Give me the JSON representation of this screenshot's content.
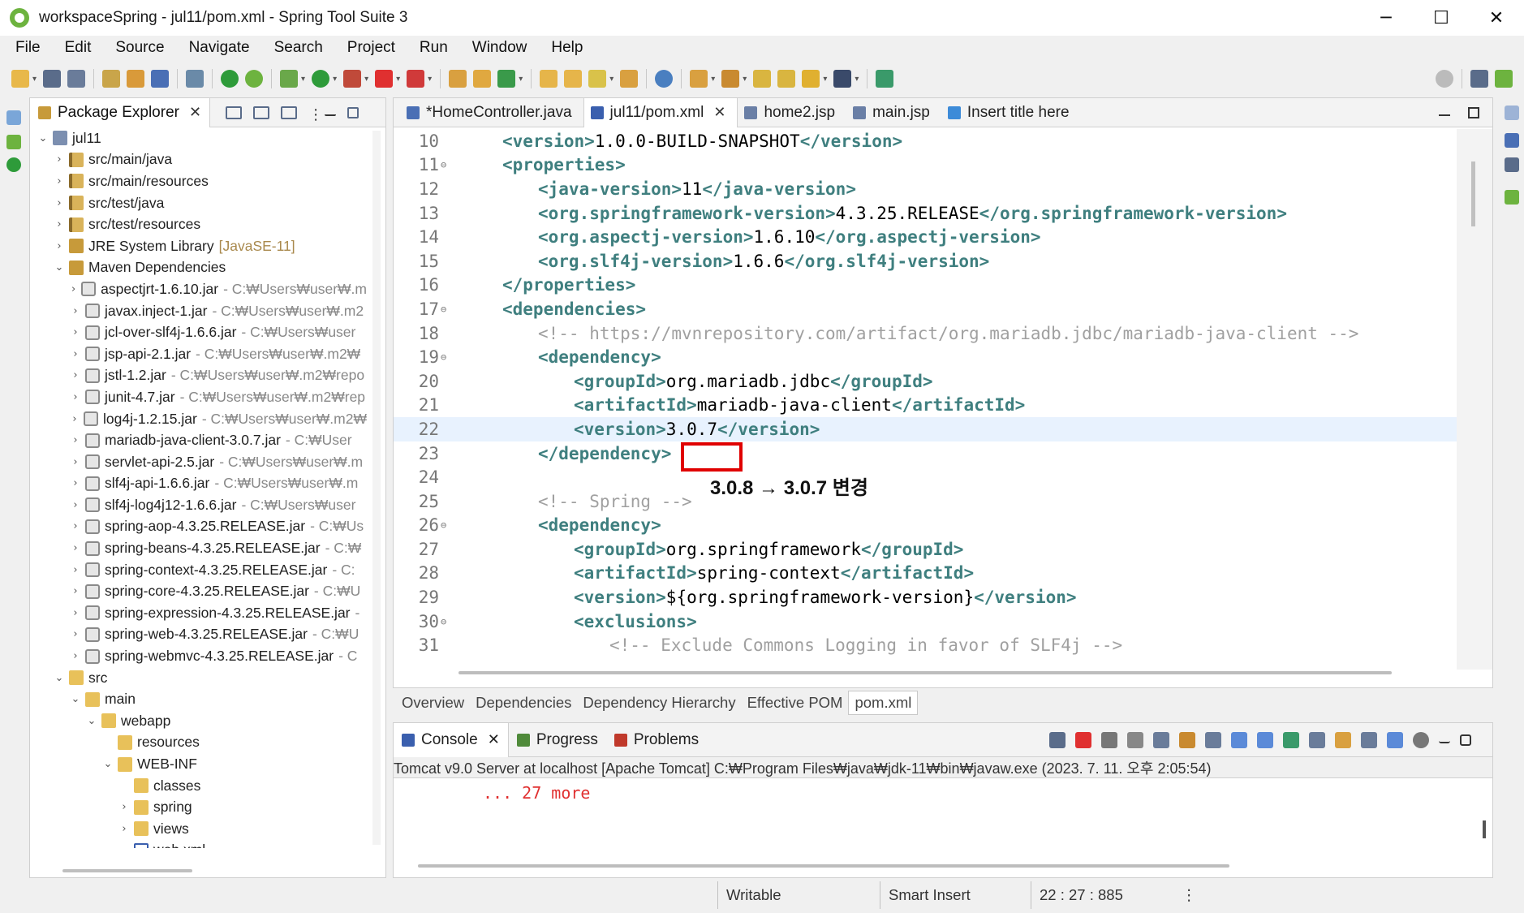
{
  "window": {
    "title": "workspaceSpring - jul11/pom.xml - Spring Tool Suite 3",
    "minimize": "─",
    "maximize": "☐",
    "close": "✕"
  },
  "menu": [
    "File",
    "Edit",
    "Source",
    "Navigate",
    "Search",
    "Project",
    "Run",
    "Window",
    "Help"
  ],
  "package_explorer": {
    "tab_label": "Package Explorer",
    "close": "✕",
    "tree": [
      {
        "depth": 0,
        "arrow": "⌄",
        "icon": "project-icon",
        "label": "jul11",
        "dec": ""
      },
      {
        "depth": 1,
        "arrow": "›",
        "icon": "source-folder-icon",
        "label": "src/main/java",
        "dec": ""
      },
      {
        "depth": 1,
        "arrow": "›",
        "icon": "source-folder-icon",
        "label": "src/main/resources",
        "dec": ""
      },
      {
        "depth": 1,
        "arrow": "›",
        "icon": "source-folder-icon",
        "label": "src/test/java",
        "dec": ""
      },
      {
        "depth": 1,
        "arrow": "›",
        "icon": "source-folder-icon",
        "label": "src/test/resources",
        "dec": ""
      },
      {
        "depth": 1,
        "arrow": "›",
        "icon": "library-icon",
        "label": "JRE System Library",
        "jre": "[JavaSE-11]"
      },
      {
        "depth": 1,
        "arrow": "⌄",
        "icon": "library-icon",
        "label": "Maven Dependencies",
        "dec": ""
      },
      {
        "depth": 2,
        "arrow": "›",
        "icon": "jar-icon",
        "label": "aspectjrt-1.6.10.jar",
        "dec": "- C:₩Users₩user₩.m"
      },
      {
        "depth": 2,
        "arrow": "›",
        "icon": "jar-icon",
        "label": "javax.inject-1.jar",
        "dec": "- C:₩Users₩user₩.m2"
      },
      {
        "depth": 2,
        "arrow": "›",
        "icon": "jar-icon",
        "label": "jcl-over-slf4j-1.6.6.jar",
        "dec": "- C:₩Users₩user"
      },
      {
        "depth": 2,
        "arrow": "›",
        "icon": "jar-icon",
        "label": "jsp-api-2.1.jar",
        "dec": "- C:₩Users₩user₩.m2₩"
      },
      {
        "depth": 2,
        "arrow": "›",
        "icon": "jar-icon",
        "label": "jstl-1.2.jar",
        "dec": "- C:₩Users₩user₩.m2₩repo"
      },
      {
        "depth": 2,
        "arrow": "›",
        "icon": "jar-icon",
        "label": "junit-4.7.jar",
        "dec": "- C:₩Users₩user₩.m2₩rep"
      },
      {
        "depth": 2,
        "arrow": "›",
        "icon": "jar-icon",
        "label": "log4j-1.2.15.jar",
        "dec": "- C:₩Users₩user₩.m2₩"
      },
      {
        "depth": 2,
        "arrow": "›",
        "icon": "jar-icon",
        "label": "mariadb-java-client-3.0.7.jar",
        "dec": "- C:₩User"
      },
      {
        "depth": 2,
        "arrow": "›",
        "icon": "jar-icon",
        "label": "servlet-api-2.5.jar",
        "dec": "- C:₩Users₩user₩.m"
      },
      {
        "depth": 2,
        "arrow": "›",
        "icon": "jar-icon",
        "label": "slf4j-api-1.6.6.jar",
        "dec": "- C:₩Users₩user₩.m"
      },
      {
        "depth": 2,
        "arrow": "›",
        "icon": "jar-icon",
        "label": "slf4j-log4j12-1.6.6.jar",
        "dec": "- C:₩Users₩user"
      },
      {
        "depth": 2,
        "arrow": "›",
        "icon": "jar-icon",
        "label": "spring-aop-4.3.25.RELEASE.jar",
        "dec": "- C:₩Us"
      },
      {
        "depth": 2,
        "arrow": "›",
        "icon": "jar-icon",
        "label": "spring-beans-4.3.25.RELEASE.jar",
        "dec": "- C:₩"
      },
      {
        "depth": 2,
        "arrow": "›",
        "icon": "jar-icon",
        "label": "spring-context-4.3.25.RELEASE.jar",
        "dec": "- C:"
      },
      {
        "depth": 2,
        "arrow": "›",
        "icon": "jar-icon",
        "label": "spring-core-4.3.25.RELEASE.jar",
        "dec": "- C:₩U"
      },
      {
        "depth": 2,
        "arrow": "›",
        "icon": "jar-icon",
        "label": "spring-expression-4.3.25.RELEASE.jar",
        "dec": "-"
      },
      {
        "depth": 2,
        "arrow": "›",
        "icon": "jar-icon",
        "label": "spring-web-4.3.25.RELEASE.jar",
        "dec": "- C:₩U"
      },
      {
        "depth": 2,
        "arrow": "›",
        "icon": "jar-icon",
        "label": "spring-webmvc-4.3.25.RELEASE.jar",
        "dec": "- C"
      },
      {
        "depth": 1,
        "arrow": "⌄",
        "icon": "folder-icon",
        "label": "src",
        "dec": ""
      },
      {
        "depth": 2,
        "arrow": "⌄",
        "icon": "folder-icon",
        "label": "main",
        "dec": ""
      },
      {
        "depth": 3,
        "arrow": "⌄",
        "icon": "folder-icon",
        "label": "webapp",
        "dec": ""
      },
      {
        "depth": 4,
        "arrow": "",
        "icon": "folder-icon",
        "label": "resources",
        "dec": ""
      },
      {
        "depth": 4,
        "arrow": "⌄",
        "icon": "folder-icon",
        "label": "WEB-INF",
        "dec": ""
      },
      {
        "depth": 5,
        "arrow": "",
        "icon": "folder-icon",
        "label": "classes",
        "dec": ""
      },
      {
        "depth": 5,
        "arrow": "›",
        "icon": "folder-icon",
        "label": "spring",
        "dec": ""
      },
      {
        "depth": 5,
        "arrow": "›",
        "icon": "folder-icon",
        "label": "views",
        "dec": ""
      },
      {
        "depth": 5,
        "arrow": "",
        "icon": "xml-file-icon",
        "label": "web.xml",
        "dec": ""
      }
    ]
  },
  "editor": {
    "tabs": [
      {
        "label": "*HomeController.java",
        "icon": "java-file-icon",
        "active": false,
        "color": "#4a6fb5"
      },
      {
        "label": "jul11/pom.xml",
        "icon": "maven-pom-icon",
        "active": true,
        "color": "#3a5fae"
      },
      {
        "label": "home2.jsp",
        "icon": "jsp-file-icon",
        "active": false,
        "color": "#6a7fa6"
      },
      {
        "label": "main.jsp",
        "icon": "jsp-file-icon",
        "active": false,
        "color": "#6a7fa6"
      },
      {
        "label": "Insert title here",
        "icon": "globe-icon",
        "active": false,
        "color": "#3d8bd8"
      }
    ],
    "lines": [
      {
        "n": "10",
        "fold": "",
        "indent": 0,
        "parts": [
          [
            "t",
            "<"
          ],
          [
            "t",
            "version"
          ],
          [
            "t",
            ">"
          ],
          [
            "v",
            "1.0.0-BUILD-SNAPSHOT"
          ],
          [
            "t",
            "</version>"
          ]
        ]
      },
      {
        "n": "11",
        "fold": "⊖",
        "indent": 0,
        "parts": [
          [
            "t",
            "<properties>"
          ]
        ]
      },
      {
        "n": "12",
        "fold": "",
        "indent": 1,
        "parts": [
          [
            "t",
            "<java-version>"
          ],
          [
            "v",
            "11"
          ],
          [
            "t",
            "</java-version>"
          ]
        ]
      },
      {
        "n": "13",
        "fold": "",
        "indent": 1,
        "parts": [
          [
            "t",
            "<org.springframework-version>"
          ],
          [
            "v",
            "4.3.25.RELEASE"
          ],
          [
            "t",
            "</org.springframework-version>"
          ]
        ]
      },
      {
        "n": "14",
        "fold": "",
        "indent": 1,
        "parts": [
          [
            "t",
            "<org.aspectj-version>"
          ],
          [
            "v",
            "1.6.10"
          ],
          [
            "t",
            "</org.aspectj-version>"
          ]
        ]
      },
      {
        "n": "15",
        "fold": "",
        "indent": 1,
        "parts": [
          [
            "t",
            "<org.slf4j-version>"
          ],
          [
            "v",
            "1.6.6"
          ],
          [
            "t",
            "</org.slf4j-version>"
          ]
        ]
      },
      {
        "n": "16",
        "fold": "",
        "indent": 0,
        "parts": [
          [
            "t",
            "</properties>"
          ]
        ]
      },
      {
        "n": "17",
        "fold": "⊖",
        "indent": 0,
        "parts": [
          [
            "t",
            "<dependencies>"
          ]
        ]
      },
      {
        "n": "18",
        "fold": "",
        "indent": 1,
        "parts": [
          [
            "cmt",
            "<!-- https://mvnrepository.com/artifact/org.mariadb.jdbc/mariadb-java-client -->"
          ]
        ]
      },
      {
        "n": "19",
        "fold": "⊖",
        "indent": 1,
        "parts": [
          [
            "t",
            "<dependency>"
          ]
        ]
      },
      {
        "n": "20",
        "fold": "",
        "indent": 2,
        "parts": [
          [
            "t",
            "<groupId>"
          ],
          [
            "v",
            "org.mariadb.jdbc"
          ],
          [
            "t",
            "</groupId>"
          ]
        ]
      },
      {
        "n": "21",
        "fold": "",
        "indent": 2,
        "parts": [
          [
            "t",
            "<artifactId>"
          ],
          [
            "v",
            "mariadb-java-client"
          ],
          [
            "t",
            "</artifactId>"
          ]
        ]
      },
      {
        "n": "22",
        "fold": "",
        "indent": 2,
        "parts": [
          [
            "t",
            "<version>"
          ],
          [
            "v",
            "3.0.7"
          ],
          [
            "t",
            "</version>"
          ]
        ],
        "current": true
      },
      {
        "n": "23",
        "fold": "",
        "indent": 1,
        "parts": [
          [
            "t",
            "</dependency>"
          ]
        ]
      },
      {
        "n": "24",
        "fold": "",
        "indent": 0,
        "parts": []
      },
      {
        "n": "25",
        "fold": "",
        "indent": 1,
        "parts": [
          [
            "cmt",
            "<!-- Spring -->"
          ]
        ]
      },
      {
        "n": "26",
        "fold": "⊖",
        "indent": 1,
        "parts": [
          [
            "t",
            "<dependency>"
          ]
        ]
      },
      {
        "n": "27",
        "fold": "",
        "indent": 2,
        "parts": [
          [
            "t",
            "<groupId>"
          ],
          [
            "v",
            "org.springframework"
          ],
          [
            "t",
            "</groupId>"
          ]
        ]
      },
      {
        "n": "28",
        "fold": "",
        "indent": 2,
        "parts": [
          [
            "t",
            "<artifactId>"
          ],
          [
            "v",
            "spring-context"
          ],
          [
            "t",
            "</artifactId>"
          ]
        ]
      },
      {
        "n": "29",
        "fold": "",
        "indent": 2,
        "parts": [
          [
            "t",
            "<version>"
          ],
          [
            "v",
            "${org.springframework-version}"
          ],
          [
            "t",
            "</version>"
          ]
        ]
      },
      {
        "n": "30",
        "fold": "⊖",
        "indent": 2,
        "parts": [
          [
            "t",
            "<exclusions>"
          ]
        ]
      },
      {
        "n": "31",
        "fold": "",
        "indent": 3,
        "parts": [
          [
            "cmt",
            "<!-- Exclude Commons Logging in favor of SLF4j -->"
          ]
        ]
      }
    ],
    "annotation": "3.0.8 → 3.0.7 변경"
  },
  "pom_tabs": [
    "Overview",
    "Dependencies",
    "Dependency Hierarchy",
    "Effective POM",
    "pom.xml"
  ],
  "pom_tabs_active": 4,
  "console": {
    "tabs": [
      {
        "label": "Console",
        "active": true,
        "color": "#3a5fae",
        "icon": "console-icon"
      },
      {
        "label": "Progress",
        "active": false,
        "color": "#4f8a3a",
        "icon": "progress-icon"
      },
      {
        "label": "Problems",
        "active": false,
        "color": "#c0392b",
        "icon": "problems-icon"
      }
    ],
    "info": "Tomcat v9.0 Server at localhost [Apache Tomcat] C:₩Program Files₩java₩jdk-11₩bin₩javaw.exe  (2023. 7. 11. 오후 2:05:54)",
    "output": "... 27 more"
  },
  "status": {
    "writable": "Writable",
    "insert_mode": "Smart Insert",
    "position": "22 : 27 : 885",
    "more": "⋮"
  },
  "colors": {
    "tag": "#3f7f7f",
    "comment": "#a0a0a0",
    "error_output": "#e03030",
    "highlight": "#e00000"
  }
}
